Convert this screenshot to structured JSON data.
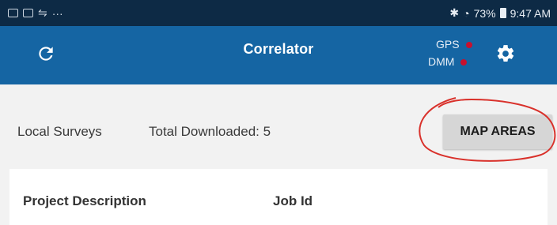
{
  "status_bar": {
    "left_glyph": "···",
    "battery": "73%",
    "time": "9:47 AM",
    "icons": [
      "notification-icon",
      "image-icon",
      "usb-icon",
      "bluetooth-icon",
      "wifi-icon",
      "battery-icon"
    ]
  },
  "app_bar": {
    "title": "Correlator",
    "gps_label": "GPS",
    "dmm_label": "DMM",
    "indicator_color": "#c8102e",
    "bar_color": "#1565a3"
  },
  "content": {
    "local_surveys": "Local Surveys",
    "total_downloaded": "Total Downloaded: 5",
    "map_areas_button": "MAP AREAS"
  },
  "table": {
    "columns": [
      "Project Description",
      "Job Id"
    ]
  },
  "annotation_color": "#d9312b"
}
